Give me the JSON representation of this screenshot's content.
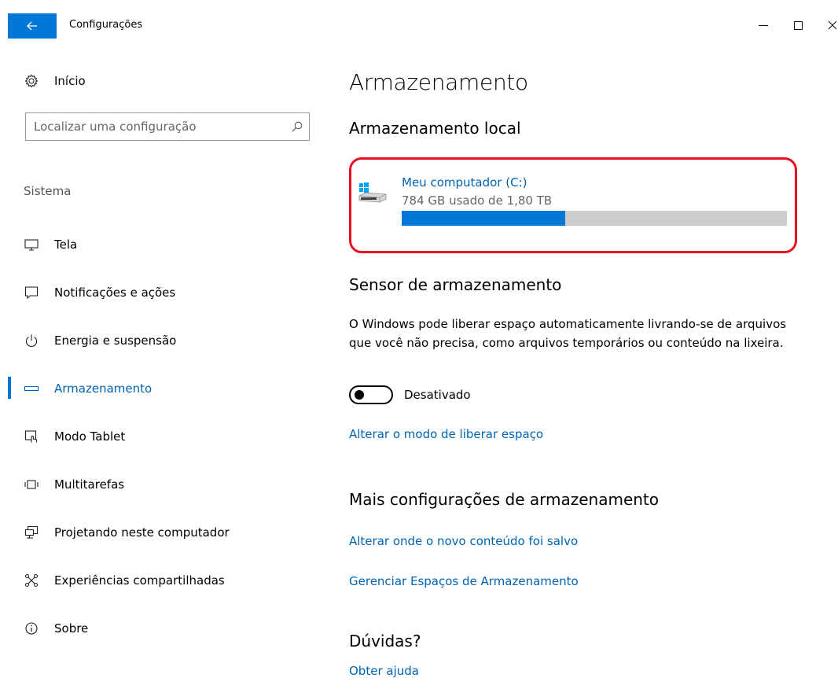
{
  "window": {
    "title": "Configurações",
    "back_icon": "arrow-left-icon",
    "controls": [
      "minimize-icon",
      "maximize-icon",
      "close-icon"
    ],
    "accent_color": "#0078d7",
    "link_color": "#0063b1"
  },
  "sidebar": {
    "home_label": "Início",
    "home_icon": "gear-icon",
    "search": {
      "placeholder": "Localizar uma configuração",
      "value": "",
      "icon": "search-icon"
    },
    "section_title": "Sistema",
    "items": [
      {
        "label": "Tela",
        "icon": "monitor-icon",
        "selected": false
      },
      {
        "label": "Notificações e ações",
        "icon": "notification-icon",
        "selected": false
      },
      {
        "label": "Energia e suspensão",
        "icon": "power-icon",
        "selected": false
      },
      {
        "label": "Armazenamento",
        "icon": "storage-icon",
        "selected": true
      },
      {
        "label": "Modo Tablet",
        "icon": "tablet-mode-icon",
        "selected": false
      },
      {
        "label": "Multitarefas",
        "icon": "multitasking-icon",
        "selected": false
      },
      {
        "label": "Projetando neste computador",
        "icon": "projecting-icon",
        "selected": false
      },
      {
        "label": "Experiências compartilhadas",
        "icon": "shared-experiences-icon",
        "selected": false
      },
      {
        "label": "Sobre",
        "icon": "info-icon",
        "selected": false
      }
    ]
  },
  "main": {
    "title": "Armazenamento",
    "local_storage": {
      "heading": "Armazenamento local",
      "drive": {
        "name": "Meu computador (C:)",
        "usage": "784 GB usado de 1,80 TB",
        "used_fraction": 0.425,
        "icon": "windows-drive-icon",
        "highlight_color": "#e81123"
      }
    },
    "storage_sense": {
      "heading": "Sensor de armazenamento",
      "description": "O Windows pode liberar espaço automaticamente livrando-se de arquivos que você não precisa, como arquivos temporários ou conteúdo na lixeira.",
      "toggle_state": "off",
      "toggle_label": "Desativado",
      "link": "Alterar o modo de liberar espaço"
    },
    "more_settings": {
      "heading": "Mais configurações de armazenamento",
      "links": [
        "Alterar onde o novo conteúdo foi salvo",
        "Gerenciar Espaços de Armazenamento"
      ]
    },
    "help": {
      "heading": "Dúvidas?",
      "link": "Obter ajuda"
    }
  }
}
